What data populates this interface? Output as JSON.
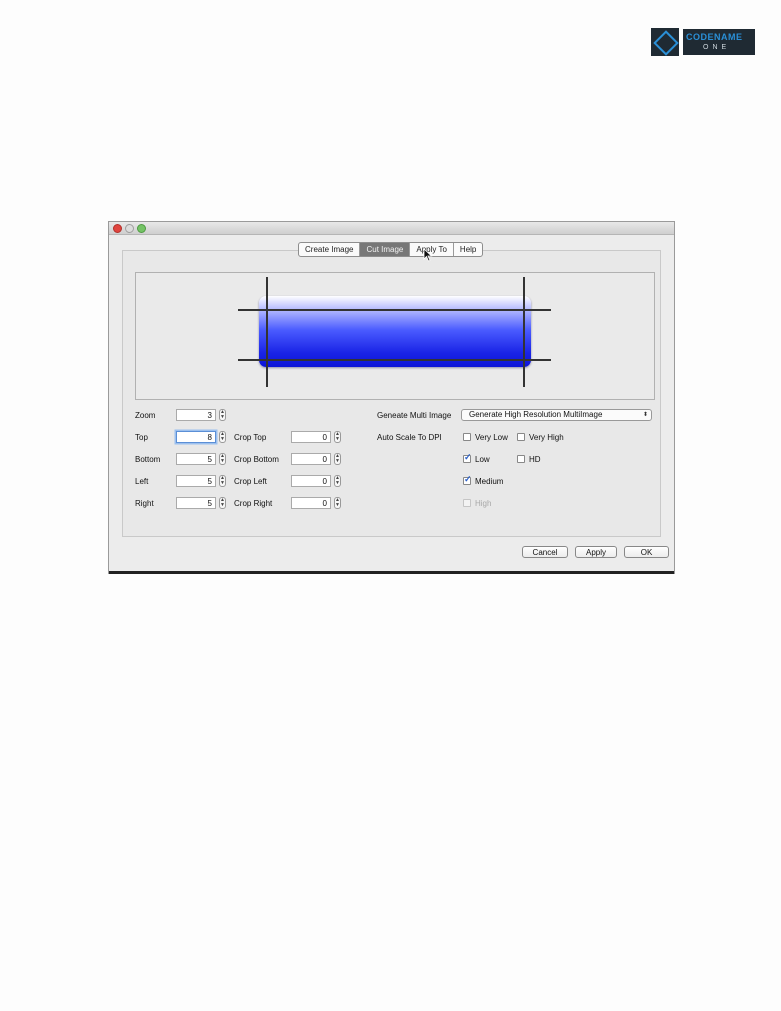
{
  "logo": {
    "line1": "CODENAME",
    "line2": "ONE"
  },
  "tabs": [
    {
      "label": "Create Image"
    },
    {
      "label": "Cut Image"
    },
    {
      "label": "Apply To"
    },
    {
      "label": "Help"
    }
  ],
  "form": {
    "zoom_label": "Zoom",
    "zoom_value": "3",
    "top_label": "Top",
    "top_value": "8",
    "bottom_label": "Bottom",
    "bottom_value": "5",
    "left_label": "Left",
    "left_value": "5",
    "right_label": "Right",
    "right_value": "5",
    "crop_top_label": "Crop Top",
    "crop_top_value": "0",
    "crop_bottom_label": "Crop Bottom",
    "crop_bottom_value": "0",
    "crop_left_label": "Crop Left",
    "crop_left_value": "0",
    "crop_right_label": "Crop Right",
    "crop_right_value": "0",
    "multi_label": "Geneate Multi Image",
    "multi_select": "Generate High Resolution MultiImage",
    "auto_scale_label": "Auto Scale To DPI"
  },
  "dpi_options": {
    "very_low": {
      "label": "Very Low",
      "checked": false
    },
    "very_high": {
      "label": "Very High",
      "checked": false
    },
    "low": {
      "label": "Low",
      "checked": true
    },
    "hd": {
      "label": "HD",
      "checked": false
    },
    "medium": {
      "label": "Medium",
      "checked": true
    },
    "high": {
      "label": "High",
      "checked": false,
      "disabled": true
    }
  },
  "buttons": {
    "cancel": "Cancel",
    "apply": "Apply",
    "ok": "OK"
  },
  "colors": {
    "gradient_top": "#ffffff",
    "gradient_bottom": "#0c14d8",
    "active_tab": "#777777",
    "checkbox_check": "#2a5fc7"
  }
}
